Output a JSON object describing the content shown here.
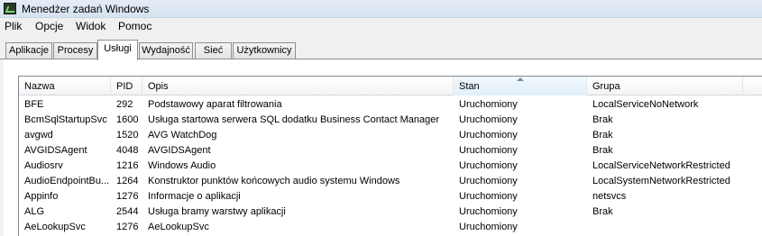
{
  "window": {
    "title": "Menedżer zadań Windows"
  },
  "menu": {
    "items": [
      "Plik",
      "Opcje",
      "Widok",
      "Pomoc"
    ]
  },
  "tabs": [
    "Aplikacje",
    "Procesy",
    "Usługi",
    "Wydajność",
    "Sieć",
    "Użytkownicy"
  ],
  "active_tab": "Usługi",
  "table": {
    "columns": [
      "Nazwa",
      "PID",
      "Opis",
      "Stan",
      "Grupa"
    ],
    "sorted_column": "Stan",
    "rows": [
      [
        "BFE",
        "292",
        "Podstawowy aparat filtrowania",
        "Uruchomiony",
        "LocalServiceNoNetwork"
      ],
      [
        "BcmSqlStartupSvc",
        "1600",
        "Usługa startowa serwera SQL dodatku Business Contact Manager",
        "Uruchomiony",
        "Brak"
      ],
      [
        "avgwd",
        "1520",
        "AVG WatchDog",
        "Uruchomiony",
        "Brak"
      ],
      [
        "AVGIDSAgent",
        "4048",
        "AVGIDSAgent",
        "Uruchomiony",
        "Brak"
      ],
      [
        "Audiosrv",
        "1216",
        "Windows Audio",
        "Uruchomiony",
        "LocalServiceNetworkRestricted"
      ],
      [
        "AudioEndpointBu...",
        "1264",
        "Konstruktor punktów końcowych audio systemu Windows",
        "Uruchomiony",
        "LocalSystemNetworkRestricted"
      ],
      [
        "Appinfo",
        "1276",
        "Informacje o aplikacji",
        "Uruchomiony",
        "netsvcs"
      ],
      [
        "ALG",
        "2544",
        "Usługa bramy warstwy aplikacji",
        "Uruchomiony",
        "Brak"
      ],
      [
        "AeLookupSvc",
        "1276",
        "AeLookupSvc",
        "Uruchomiony",
        ""
      ]
    ]
  },
  "colors": {
    "title_bar": "#dbe6f3",
    "tab_border": "#8e8f8f",
    "sort_arrow": "#6a8fb5"
  }
}
